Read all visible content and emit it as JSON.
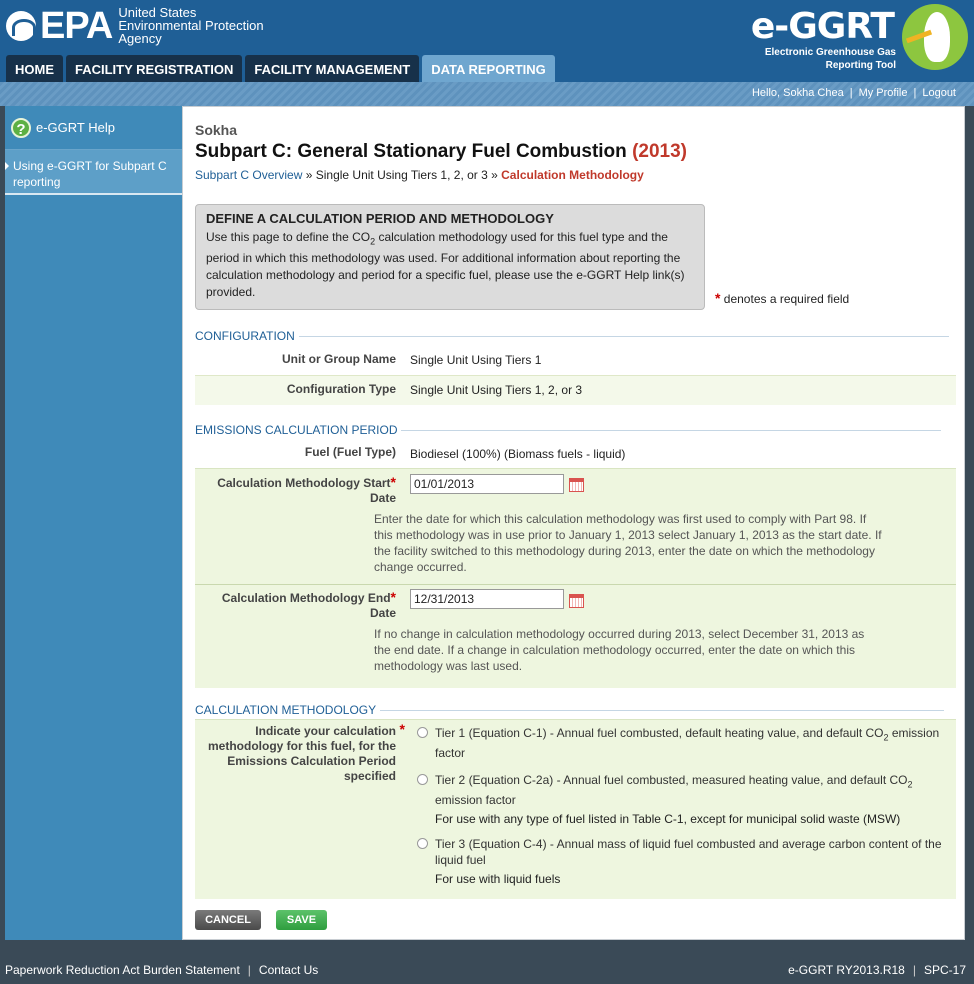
{
  "header": {
    "epa_word": "EPA",
    "agency_lines": [
      "United States",
      "Environmental Protection",
      "Agency"
    ],
    "tabs": [
      {
        "label": "HOME",
        "active": false
      },
      {
        "label": "FACILITY REGISTRATION",
        "active": false
      },
      {
        "label": "FACILITY MANAGEMENT",
        "active": false
      },
      {
        "label": "DATA REPORTING",
        "active": true
      }
    ],
    "brand_title": "e-GGRT",
    "brand_sub_1": "Electronic Greenhouse Gas",
    "brand_sub_2": "Reporting Tool"
  },
  "userbar": {
    "greeting": "Hello, Sokha Chea",
    "profile": "My Profile",
    "logout": "Logout"
  },
  "sidebar": {
    "help_label": "e-GGRT Help",
    "help_glyph": "?",
    "items": [
      {
        "label": "Using e-GGRT for Subpart C reporting"
      }
    ]
  },
  "main": {
    "facility": "Sokha",
    "title": "Subpart C: General Stationary Fuel Combustion",
    "year": "(2013)",
    "breadcrumb": {
      "link": "Subpart C Overview",
      "sep1": " » ",
      "middle": "Single Unit Using Tiers 1, 2, or 3",
      "sep2": " » ",
      "current": "Calculation Methodology"
    },
    "infobox": {
      "heading": "DEFINE A CALCULATION PERIOD AND METHODOLOGY",
      "text_before": "Use this page to define the CO",
      "sub": "2",
      "text_after": " calculation methodology used for this fuel type and the period in which this methodology was used. For additional information about reporting the calculation methodology and period for a specific fuel, please use the e-GGRT Help link(s) provided."
    },
    "required_star": "*",
    "required_note": " denotes a required field",
    "configuration": {
      "heading": "CONFIGURATION",
      "unit_label": "Unit or Group Name",
      "unit_value": "Single Unit Using Tiers 1",
      "type_label": "Configuration Type",
      "type_value": "Single Unit Using Tiers 1, 2, or 3"
    },
    "period": {
      "heading": "EMISSIONS CALCULATION PERIOD",
      "fuel_label": "Fuel (Fuel Type)",
      "fuel_value": "Biodiesel (100%) (Biomass fuels - liquid)",
      "start_label_1": "Calculation Methodology Start",
      "start_label_2": "Date",
      "start_value": "01/01/2013",
      "start_hint": "Enter the date for which this calculation methodology was first used to comply with Part 98. If this methodology was in use prior to January 1, 2013 select January 1, 2013 as the start date. If the facility switched to this methodology during 2013, enter the date on which the methodology change occurred.",
      "end_label_1": "Calculation Methodology End",
      "end_label_2": "Date",
      "end_value": "12/31/2013",
      "end_hint": "If no change in calculation methodology occurred during 2013, select December 31, 2013 as the end date. If a change in calculation methodology occurred, enter the date on which this methodology was last used."
    },
    "methodology": {
      "heading": "CALCULATION METHODOLOGY",
      "label": "Indicate your calculation methodology for this fuel, for the Emissions Calculation Period specified",
      "options": [
        {
          "text_before": "Tier 1 (Equation C-1) - Annual fuel combusted, default heating value, and default CO",
          "sub": "2",
          "text_after": " emission factor",
          "note": ""
        },
        {
          "text_before": "Tier 2 (Equation C-2a) - Annual fuel combusted, measured heating value, and default CO",
          "sub": "2",
          "text_after": " emission factor",
          "note": "For use with any type of fuel listed in Table C-1, except for municipal solid waste (MSW)"
        },
        {
          "text_before": "Tier 3 (Equation C-4) - Annual mass of liquid fuel combusted and average carbon content of the liquid fuel",
          "sub": "",
          "text_after": "",
          "note": "For use with liquid fuels"
        }
      ]
    },
    "buttons": {
      "cancel": "CANCEL",
      "save": "SAVE"
    }
  },
  "footer": {
    "left_1": "Paperwork Reduction Act Burden Statement",
    "left_2": "Contact Us",
    "right_1": "e-GGRT RY2013.R18",
    "right_2": "SPC-17"
  }
}
